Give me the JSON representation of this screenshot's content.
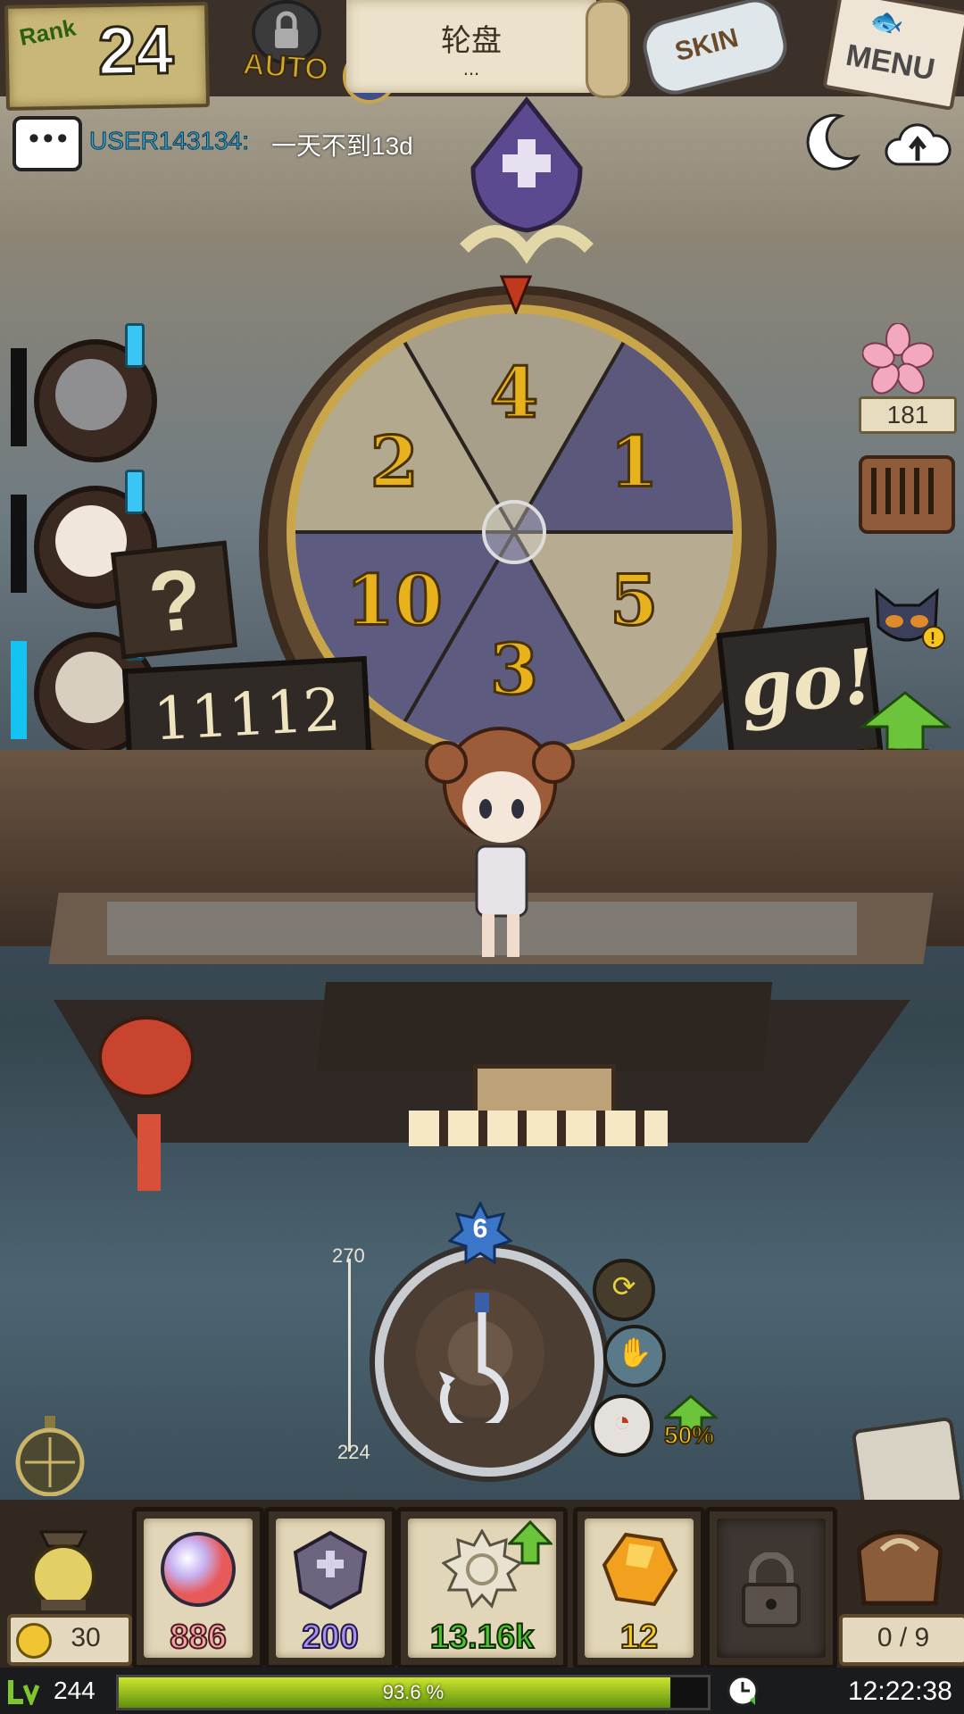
{
  "top": {
    "rank_label": "Rank",
    "rank_value": "24",
    "auto_label": "AUTO",
    "mode_title": "轮盘",
    "mode_subtitle": "...",
    "skin_label": "SKIN",
    "menu_label": "MENU"
  },
  "chat": {
    "user": "USER143134:",
    "message": "一天不到13d"
  },
  "wheel": {
    "segments": [
      "4",
      "1",
      "5",
      "3",
      "10",
      "2"
    ],
    "segment_colors": [
      "#a89f8a",
      "#5b587c",
      "#b7ac91",
      "#5e5b80",
      "#5e5b80",
      "#b3a98f"
    ]
  },
  "left_panel": {
    "question_mark": "?",
    "counter": "11112"
  },
  "go_label": "go!",
  "right_panel": {
    "flower_count": "181",
    "boost_percent": "50%"
  },
  "hook": {
    "gauge_top": "270",
    "gauge_bottom": "224",
    "level": "6",
    "boost_percent": "50%"
  },
  "inventory": {
    "lamp_count": "30",
    "slots": [
      {
        "value": "886"
      },
      {
        "value": "200"
      },
      {
        "value": "13.16k"
      },
      {
        "value": "12"
      }
    ],
    "bag_count": "0 / 9"
  },
  "status": {
    "level": "244",
    "xp_percent": 93.6,
    "xp_label": "93.6 %",
    "time": "12:22:38"
  },
  "colors": {
    "accent_blue": "#15c3f2",
    "boost_yellow": "#f7d020",
    "xp_green": "#8ab21a"
  }
}
